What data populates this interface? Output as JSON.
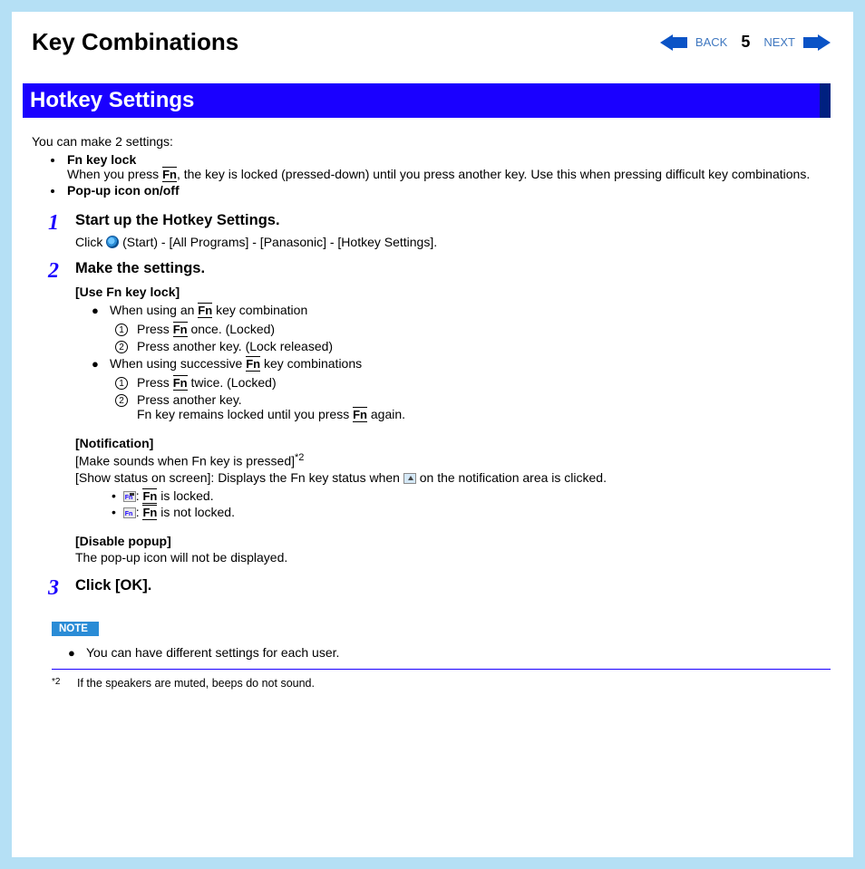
{
  "nav": {
    "back": "BACK",
    "next": "NEXT",
    "page": "5"
  },
  "pageTitle": "Key Combinations",
  "sectionHeader": "Hotkey Settings",
  "intro": "You can make 2 settings:",
  "key": "Fn",
  "settings": {
    "item1_title": "Fn key lock",
    "item1_desc1": "When you press ",
    "item1_desc2": ", the key is locked (pressed-down) until you press another key. Use this when pressing difficult key combinations.",
    "item2_title": "Pop-up icon on/off"
  },
  "step1": {
    "num": "1",
    "title": "Start up the Hotkey Settings.",
    "text1": "Click ",
    "text2": " (Start) - [All Programs] - [Panasonic] - [Hotkey Settings]."
  },
  "step2": {
    "num": "2",
    "title": "Make the settings.",
    "sub1_heading": "[Use Fn key lock]",
    "b1_pre": "When using an ",
    "b1_post": " key combination",
    "b1_s1_pre": "Press ",
    "b1_s1_post": " once. (Locked)",
    "b1_s2": "Press another key. (Lock released)",
    "b2_pre": "When using successive ",
    "b2_post": " key combinations",
    "b2_s1_pre": "Press ",
    "b2_s1_post": " twice. (Locked)",
    "b2_s2": "Press another key.",
    "b2_s2b_pre": "Fn key remains locked until you press ",
    "b2_s2b_post": " again.",
    "sub2_heading": "[Notification]",
    "notif_line1": "[Make sounds when Fn key is pressed]",
    "notif_sup": "*2",
    "notif_line2_pre": "[Show status on screen]: Displays the Fn key status when ",
    "notif_line2_post": " on the notification area is clicked.",
    "status_locked_pre": ": ",
    "status_locked_post": " is locked.",
    "status_unlocked_pre": ": ",
    "status_unlocked_post": " is not locked.",
    "sub3_heading": "[Disable popup]",
    "sub3_text": "The pop-up icon will not be displayed."
  },
  "step3": {
    "num": "3",
    "title": "Click [OK]."
  },
  "note": {
    "label": "NOTE",
    "text": "You can have different settings for each user."
  },
  "footnote": {
    "mark": "*2",
    "text": "If the speakers are muted, beeps do not sound."
  }
}
